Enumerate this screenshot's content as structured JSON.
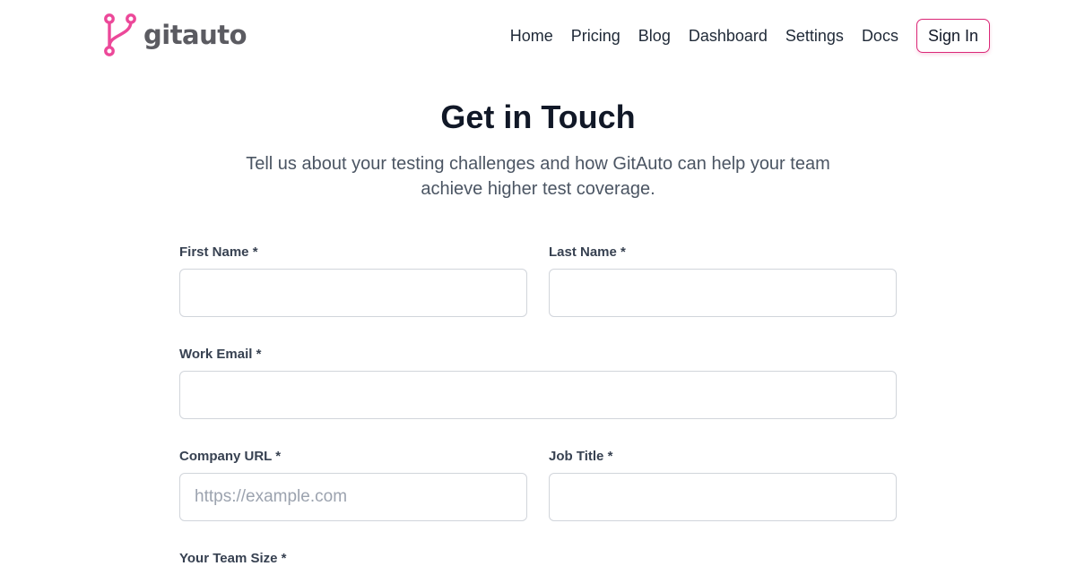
{
  "header": {
    "brand": "gitauto",
    "nav": [
      {
        "label": "Home"
      },
      {
        "label": "Pricing"
      },
      {
        "label": "Blog"
      },
      {
        "label": "Dashboard"
      },
      {
        "label": "Settings"
      },
      {
        "label": "Docs"
      }
    ],
    "sign_in_label": "Sign In"
  },
  "main": {
    "title": "Get in Touch",
    "subtitle": "Tell us about your testing challenges and how GitAuto can help your team achieve higher test coverage."
  },
  "form": {
    "first_name": {
      "label": "First Name *",
      "value": "",
      "placeholder": ""
    },
    "last_name": {
      "label": "Last Name *",
      "value": "",
      "placeholder": ""
    },
    "work_email": {
      "label": "Work Email *",
      "value": "",
      "placeholder": ""
    },
    "company_url": {
      "label": "Company URL *",
      "value": "",
      "placeholder": "https://example.com"
    },
    "job_title": {
      "label": "Job Title *",
      "value": "",
      "placeholder": ""
    },
    "team_size": {
      "label": "Your Team Size *"
    }
  },
  "colors": {
    "brand_pink": "#ec4899",
    "sign_in_border": "#db2777"
  },
  "icons": {
    "logo": "git-branch-icon"
  }
}
